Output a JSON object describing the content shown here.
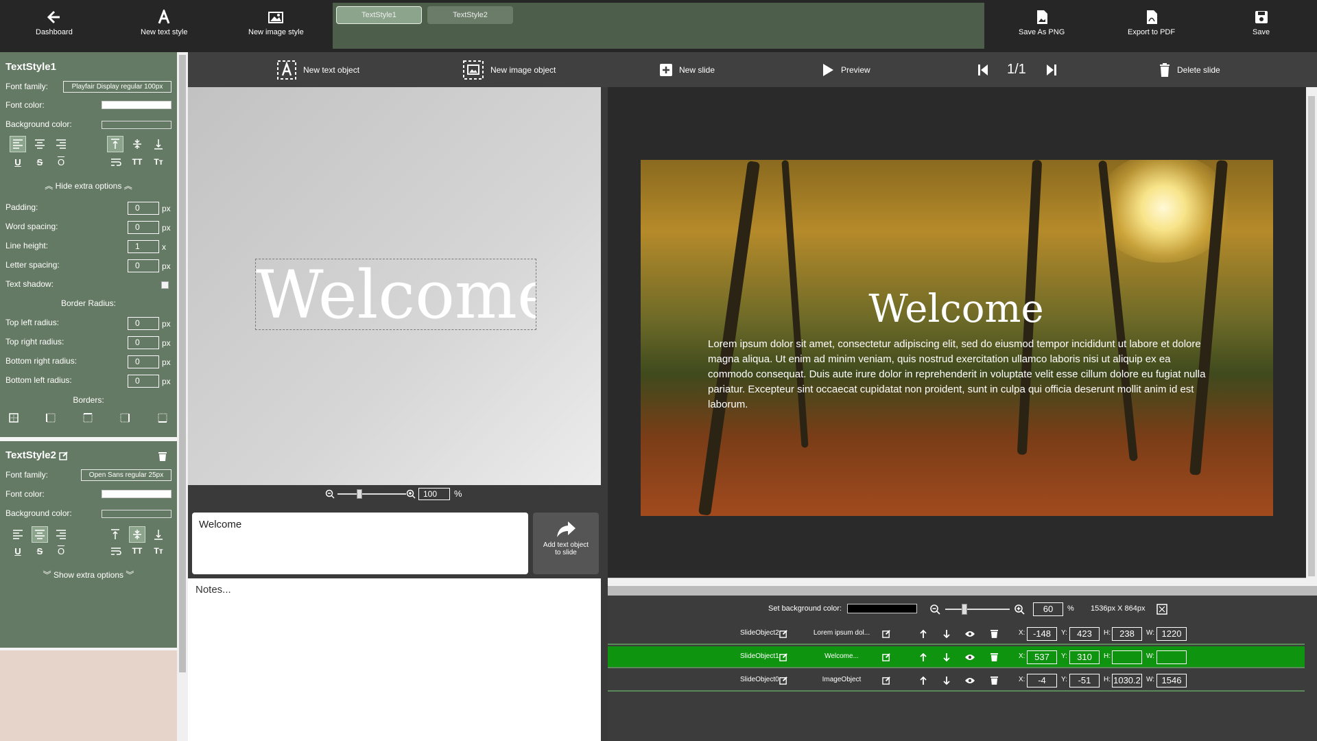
{
  "top": {
    "dashboard": "Dashboard",
    "new_text_style": "New text style",
    "new_image_style": "New image style",
    "save_png": "Save As PNG",
    "export_pdf": "Export to PDF",
    "save": "Save"
  },
  "style_tabs": [
    {
      "label": "TextStyle1",
      "active": true
    },
    {
      "label": "TextStyle2",
      "active": false
    }
  ],
  "toolbar": {
    "new_text_object": "New text object",
    "new_image_object": "New image object",
    "new_slide": "New slide",
    "preview": "Preview",
    "page": "1/1",
    "delete_slide": "Delete slide"
  },
  "style1": {
    "title": "TextStyle1",
    "font_family_label": "Font family:",
    "font_family_value": "Playfair Display regular 100px",
    "font_color_label": "Font color:",
    "bg_color_label": "Background color:",
    "hide_extra": "Hide extra options",
    "padding_label": "Padding:",
    "padding": "0",
    "word_spacing_label": "Word spacing:",
    "word_spacing": "0",
    "line_height_label": "Line height:",
    "line_height": "1",
    "letter_spacing_label": "Letter spacing:",
    "letter_spacing": "0",
    "text_shadow_label": "Text shadow:",
    "border_radius_heading": "Border Radius:",
    "tl_label": "Top left radius:",
    "tl": "0",
    "tr_label": "Top right radius:",
    "tr": "0",
    "br_label": "Bottom right radius:",
    "br": "0",
    "bl_label": "Bottom left radius:",
    "bl": "0",
    "borders_heading": "Borders:",
    "px": "px",
    "x": "x"
  },
  "style2": {
    "title": "TextStyle2",
    "font_family_label": "Font family:",
    "font_family_value": "Open Sans regular 25px",
    "font_color_label": "Font color:",
    "bg_color_label": "Background color:",
    "show_extra": "Show extra options"
  },
  "editor": {
    "text": "Welcome",
    "zoom": "100",
    "percent": "%",
    "textbox": "Welcome",
    "add_btn_line1": "Add text object",
    "add_btn_line2": "to slide",
    "notes": "Notes..."
  },
  "slide": {
    "title": "Welcome",
    "body": "Lorem ipsum dolor sit amet, consectetur adipiscing elit, sed do eiusmod tempor incididunt ut labore et dolore magna aliqua. Ut enim ad minim veniam, quis nostrud exercitation ullamco laboris nisi ut aliquip ex ea commodo consequat. Duis aute irure dolor in reprehenderit in voluptate velit esse cillum dolore eu fugiat nulla pariatur. Excepteur sint occaecat cupidatat non proident, sunt in culpa qui officia deserunt mollit anim id est laborum."
  },
  "objects": {
    "bg_label": "Set background color:",
    "zoom": "60",
    "percent": "%",
    "dimensions": "1536px X 864px",
    "rows": [
      {
        "name": "SlideObject2",
        "content": "Lorem ipsum dol...",
        "x": "-148",
        "y": "423",
        "h": "238",
        "w": "1220",
        "selected": false
      },
      {
        "name": "SlideObject1",
        "content": "Welcome...",
        "x": "537",
        "y": "310",
        "h": "",
        "w": "",
        "selected": true
      },
      {
        "name": "SlideObject0",
        "content": "ImageObject",
        "x": "-4",
        "y": "-51",
        "h": "1030.2",
        "w": "1546",
        "selected": false
      }
    ],
    "x_lbl": "X:",
    "y_lbl": "Y:",
    "h_lbl": "H:",
    "w_lbl": "W:"
  },
  "colors": {
    "panel": "#657a64",
    "selected_row": "#0f9410",
    "style_strip": "#4d5e4b"
  }
}
